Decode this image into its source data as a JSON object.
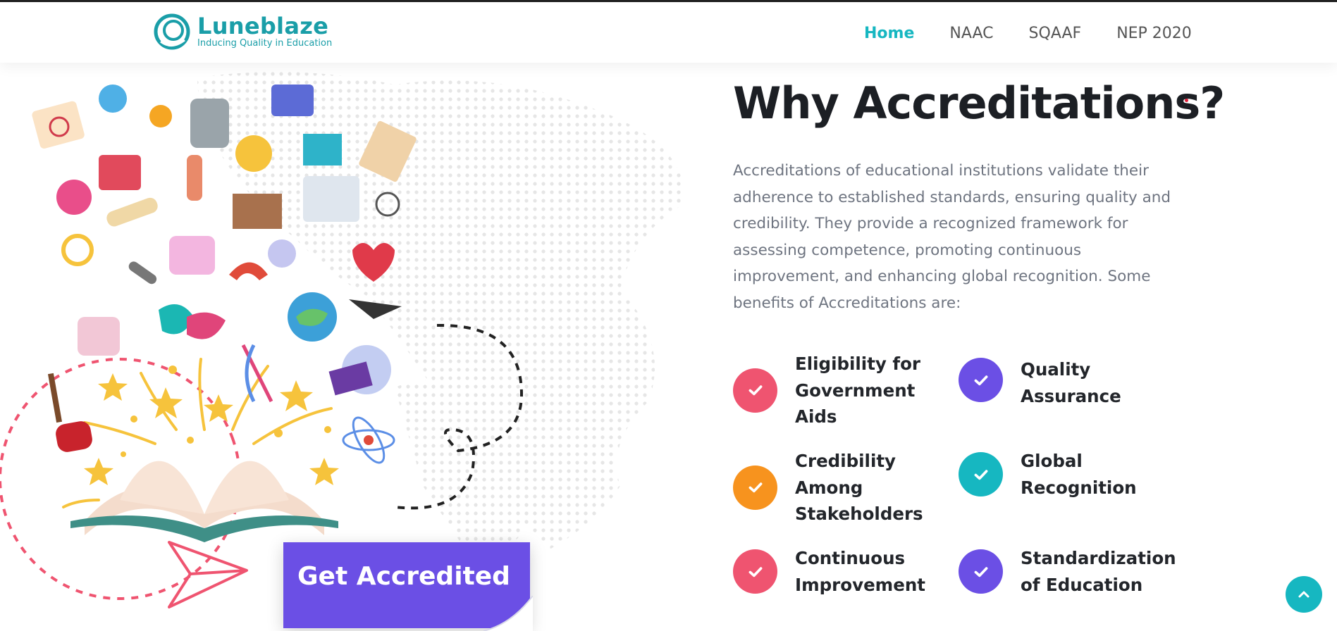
{
  "brand": {
    "name": "Luneblaze",
    "tagline": "Inducing Quality in Education",
    "color": "#1a9ea8"
  },
  "nav": {
    "items": [
      {
        "label": "Home",
        "active": true
      },
      {
        "label": "NAAC",
        "active": false
      },
      {
        "label": "SQAAF",
        "active": false
      },
      {
        "label": "NEP 2020",
        "active": false
      }
    ],
    "active_color": "#16b7c1"
  },
  "main": {
    "heading": "Why Accreditations?",
    "description": "Accreditations of educational institutions validate their adherence to established standards, ensuring quality and credibility. They provide a recognized framework for assessing competence, promoting continuous improvement, and enhancing global recognition. Some benefits of Accreditations are:",
    "benefits": [
      {
        "label": "Eligibility for Government Aids",
        "color": "#ef5470"
      },
      {
        "label": "Quality Assurance",
        "color": "#6b4fe5"
      },
      {
        "label": "Credibility Among Stakeholders",
        "color": "#f7931e"
      },
      {
        "label": "Global Recognition",
        "color": "#16b7c1"
      },
      {
        "label": "Continuous Improvement",
        "color": "#ef5470"
      },
      {
        "label": "Standardization of Education",
        "color": "#6b4fe5"
      }
    ]
  },
  "cta": {
    "label": "Get Accredited",
    "color": "#6b4fe5"
  },
  "icons": [
    "check-icon",
    "arrow-up-icon",
    "open-book-illustration",
    "paper-plane-illustration"
  ]
}
